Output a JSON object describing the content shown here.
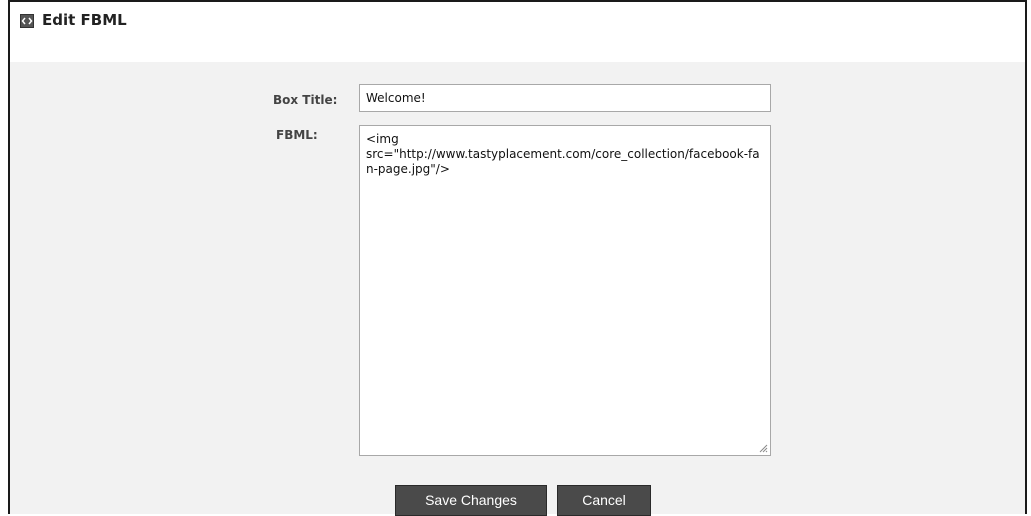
{
  "header": {
    "title": "Edit FBML",
    "icon": "fbml-box-icon"
  },
  "form": {
    "box_title_label": "Box Title:",
    "box_title_value": "Welcome!",
    "fbml_label": "FBML:",
    "fbml_value": "<img\nsrc=\"http://www.tastyplacement.com/core_collection/facebook-fan-page.jpg\"/>"
  },
  "buttons": {
    "save_label": "Save Changes",
    "cancel_label": "Cancel"
  },
  "colors": {
    "button_bg": "#4a4a4a",
    "panel_bg": "#f2f2f2"
  }
}
